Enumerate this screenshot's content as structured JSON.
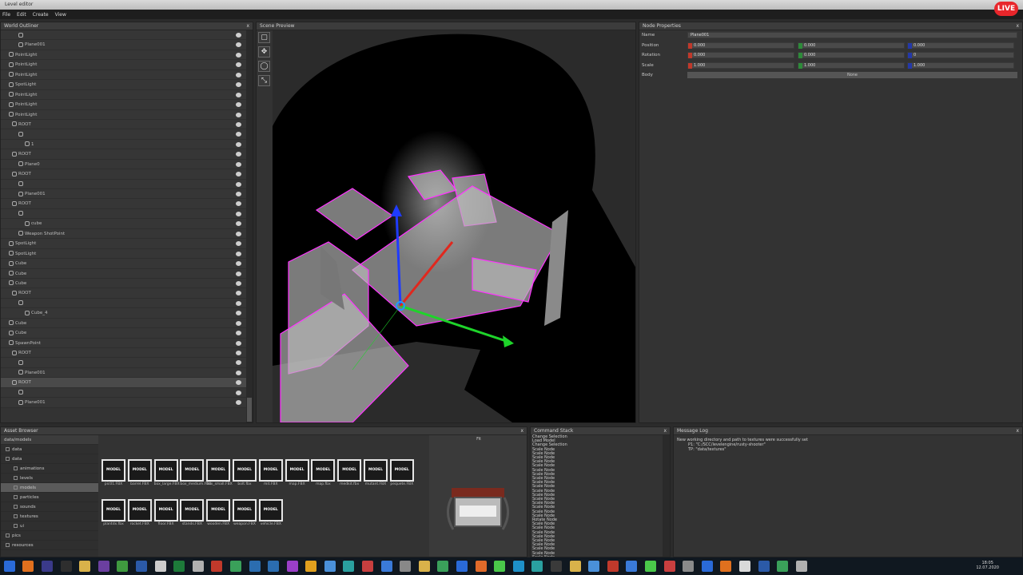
{
  "window": {
    "title": "Level editor",
    "live_badge": "LIVE"
  },
  "menu": [
    "File",
    "Edit",
    "Create",
    "View"
  ],
  "outliner": {
    "title": "World Outliner",
    "close": "x",
    "rows": [
      "",
      "Plane001",
      "PointLight",
      "PointLight",
      "PointLight",
      "SpotLight",
      "PointLight",
      "PointLight",
      "PointLight",
      "ROOT",
      "",
      "1",
      "ROOT",
      "Plane0",
      "ROOT",
      "",
      "Plane001",
      "ROOT",
      "",
      "cube",
      "Weapon ShotPoint",
      "SpotLight",
      "SpotLight",
      "Cube",
      "Cube",
      "Cube",
      "ROOT",
      "",
      "Cube_4",
      "Cube",
      "Cube",
      "SpawnPoint",
      "ROOT",
      "",
      "Plane001",
      "ROOT",
      "",
      "Plane001"
    ],
    "selected_index": 35
  },
  "scene": {
    "title": "Scene Preview",
    "tools": [
      "select-icon",
      "move-icon",
      "rotate-icon",
      "scale-icon"
    ]
  },
  "properties": {
    "title": "Node Properties",
    "close": "x",
    "name_label": "Name",
    "name_value": "Plane001",
    "rows": [
      {
        "label": "Position",
        "x": "0.000",
        "y": "0.000",
        "z": "0.000"
      },
      {
        "label": "Rotation",
        "x": "0.000",
        "y": "0.000",
        "z": "0"
      },
      {
        "label": "Scale",
        "x": "1.000",
        "y": "1.000",
        "z": "1.000"
      }
    ],
    "body_label": "Body",
    "body_value": "None",
    "axis_colors": {
      "x": "#c0392b",
      "y": "#2e8b3a",
      "z": "#2438a8"
    }
  },
  "asset_browser": {
    "title": "Asset Browser",
    "close": "x",
    "root": "data/models",
    "tree": [
      "data",
      "data",
      "animations",
      "levels",
      "models",
      "particles",
      "sounds",
      "textures",
      "ui",
      "pics",
      "resources"
    ],
    "selected_tree_index": 4,
    "thumb_label": "MODEL",
    "assets_row1": [
      "pic01.FBX",
      "barrel.FBX",
      "box_large.FBX",
      "box_medium.FBX",
      "box_small.FBX",
      "bolt.fbx",
      "mit.FBX",
      "map.FBX",
      "map.fbx",
      "medkit.fbx",
      "mutant.FBX",
      "pequete.FBX"
    ],
    "assets_row2": [
      "plantdx.fbx",
      "rocket.FBX",
      "floor.FBX",
      "stands.FBX",
      "wooden.FBX",
      "weapon.FBX",
      "vehicle.FBX"
    ],
    "preview_caption": "Fit"
  },
  "command_stack": {
    "title": "Command Stack",
    "close": "x",
    "items": [
      "Change Selection",
      "Load Model",
      "Change Selection",
      "Scale Node",
      "Scale Node",
      "Scale Node",
      "Scale Node",
      "Scale Node",
      "Scale Node",
      "Scale Node",
      "Scale Node",
      "Scale Node",
      "Scale Node",
      "Scale Node",
      "Scale Node",
      "Scale Node",
      "Scale Node",
      "Scale Node",
      "Scale Node",
      "Scale Node",
      "Rotate Node",
      "Scale Node",
      "Scale Node",
      "Scale Node",
      "Scale Node",
      "Scale Node",
      "Scale Node",
      "Scale Node",
      "Scale Node",
      "Scale Node",
      "Scale Node",
      "Scale Node"
    ]
  },
  "message_log": {
    "title": "Message Log",
    "close": "x",
    "lines": [
      "New working directory and path to textures were successfully set",
      "P1: \"C:/SCC/levelengine/rusty-shooter\"",
      "TP: \"data/textures\""
    ]
  },
  "taskbar": {
    "icon_colors": [
      "#2a6ad8",
      "#e0701e",
      "#3a3a8a",
      "#2e2e2e",
      "#d9b24a",
      "#6b3fa0",
      "#3f9a3f",
      "#2b5aa8",
      "#cccccc",
      "#1d7a3a",
      "#b0b0b0",
      "#c0392b",
      "#3aa05a",
      "#2b6db0",
      "#2b6db0",
      "#9b3fc8",
      "#e0a01e",
      "#4a90d9",
      "#2aa0a0",
      "#c83f3f",
      "#3a7ad8",
      "#888888",
      "#d9b24a",
      "#3aa05a",
      "#2a6ad8",
      "#e06a2a",
      "#4ac84a",
      "#1e90c8",
      "#2aa0a0",
      "#3a3a3a",
      "#d9b24a",
      "#4a90d9",
      "#c0392b",
      "#3a7ad8",
      "#4ac84a",
      "#c83f3f",
      "#8a8a8a",
      "#2a6ad8",
      "#e0701e",
      "#d9d9d9",
      "#2b5aa8",
      "#3aa05a",
      "#b0b0b0"
    ],
    "time": "18:05",
    "date": "12.07.2020"
  }
}
